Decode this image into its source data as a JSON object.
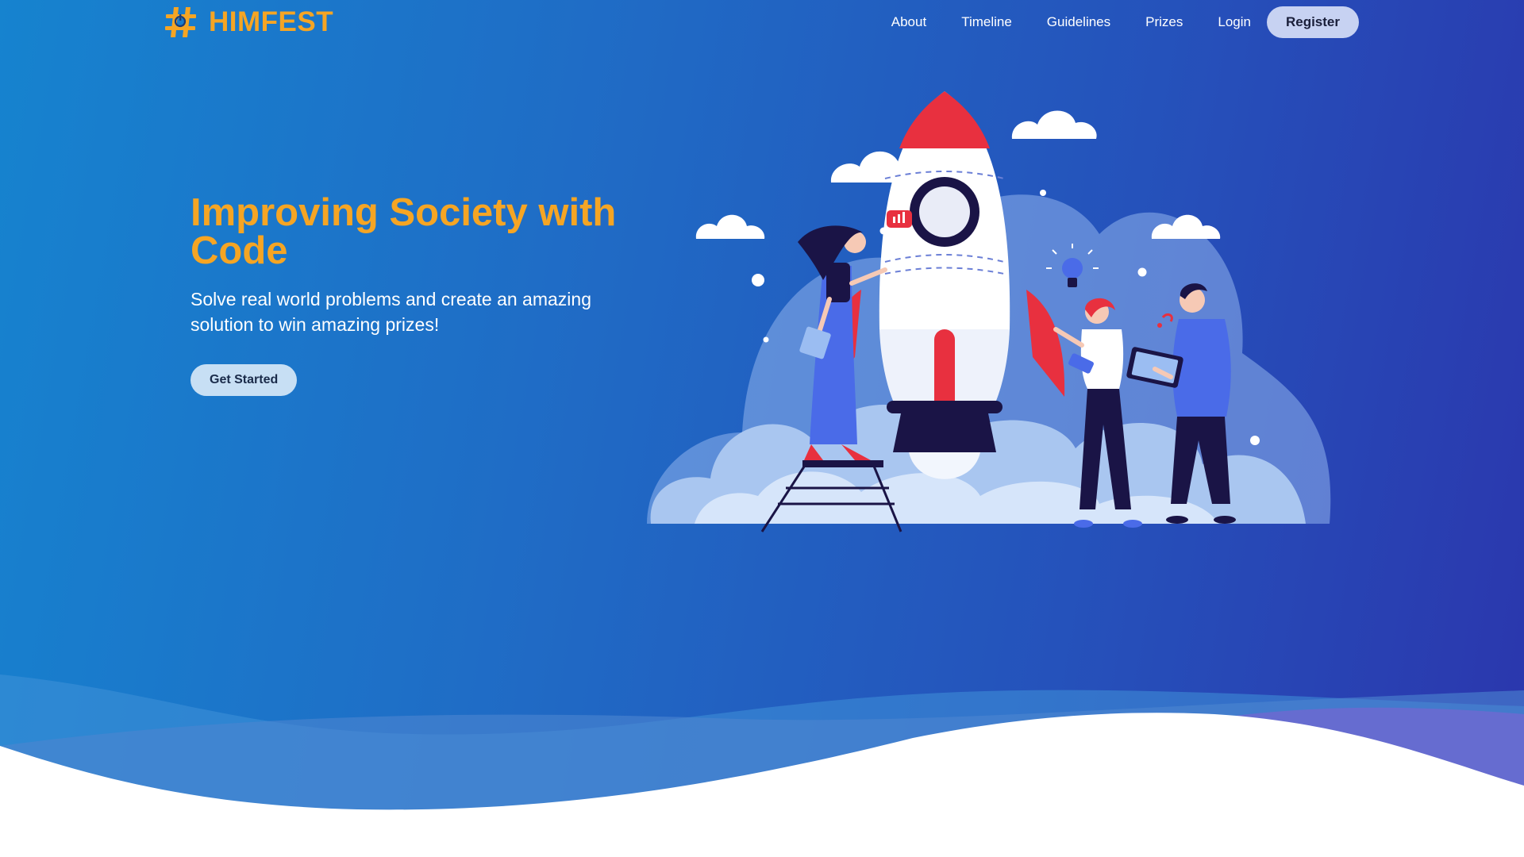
{
  "brand": {
    "name": "HIMFEST",
    "icon": "hashtag-power-icon",
    "color": "#f5a524"
  },
  "nav": {
    "links": [
      "About",
      "Timeline",
      "Guidelines",
      "Prizes",
      "Login"
    ],
    "register_label": "Register"
  },
  "hero": {
    "title": "Improving Society with Code",
    "subtitle": "Solve real world problems and create an amazing solution to win amazing prizes!",
    "cta_label": "Get Started"
  },
  "illustration": {
    "name": "rocket-launch-illustration"
  },
  "colors": {
    "accent": "#f5a524",
    "gradient_start": "#1683cf",
    "gradient_end": "#2b36ad",
    "button_bg": "#c7d2f2"
  }
}
